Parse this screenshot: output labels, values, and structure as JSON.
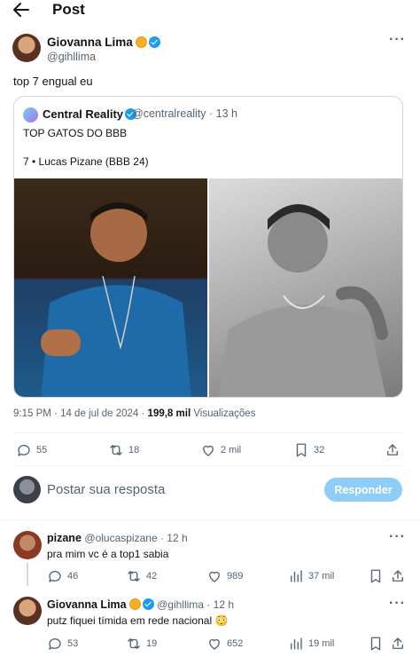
{
  "header": {
    "title": "Post"
  },
  "post": {
    "author_name": "Giovanna Lima",
    "author_handle": "@gihllima",
    "text": "top 7 engual eu",
    "quote": {
      "author_name": "Central Reality",
      "author_handle": "@centralreality",
      "time": "13 h",
      "line1": "TOP GATOS DO BBB",
      "line2": "7 • Lucas Pizane (BBB 24)"
    },
    "meta": {
      "time": "9:15 PM",
      "date": "14 de jul de 2024",
      "views_count": "199,8 mil",
      "views_label": "Visualizações"
    },
    "actions": {
      "replies": "55",
      "reposts": "18",
      "likes": "2 mil",
      "bookmarks": "32"
    }
  },
  "composer": {
    "placeholder": "Postar sua resposta",
    "button_label": "Responder"
  },
  "comments": [
    {
      "name": "pizane",
      "handle": "@olucaspizane",
      "time": "12 h",
      "text": "pra mim vc é a top1 sabia",
      "replies": "46",
      "reposts": "42",
      "likes": "989",
      "views": "37 mil"
    },
    {
      "name": "Giovanna Lima",
      "handle": "@gihllima",
      "time": "12 h",
      "text": "putz fiquei tímida em rede nacional 😳",
      "replies": "53",
      "reposts": "19",
      "likes": "652",
      "views": "19 mil"
    }
  ],
  "colors": {
    "accent": "#1d9bf0",
    "reply_button": "#8ecdf8",
    "muted": "#536471",
    "border": "#cfd9de"
  }
}
